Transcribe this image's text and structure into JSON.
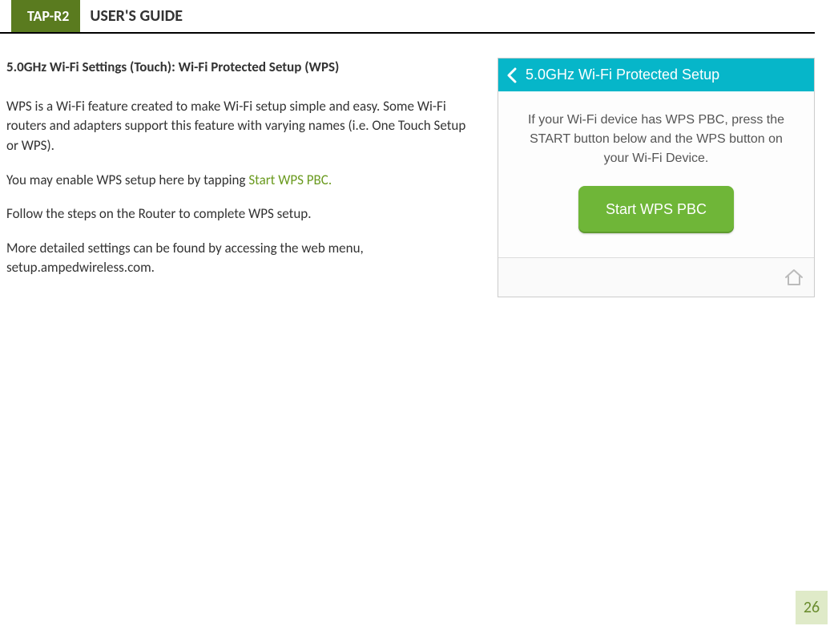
{
  "header": {
    "badge": "TAP-R2",
    "title": "USER'S GUIDE"
  },
  "section": {
    "heading": "5.0GHz Wi-Fi Settings (Touch): Wi-Fi Protected Setup (WPS)",
    "p1": "WPS is a Wi-Fi feature created to make Wi-Fi setup simple and easy.  Some Wi-Fi routers and adapters support this feature with varying names (i.e. One Touch Setup or WPS).",
    "p2_prefix": "You may enable WPS setup here by tapping ",
    "p2_link": "Start WPS PBC.",
    "p3": "Follow the steps on the Router to complete WPS setup.",
    "p4": "More detailed settings can be found by accessing the web menu, setup.ampedwireless.com."
  },
  "device": {
    "topbar_title": "5.0GHz Wi-Fi Protected Setup",
    "body_text": "If your Wi-Fi device has WPS PBC, press the START button below and the WPS button on your Wi-Fi Device.",
    "button_label": "Start WPS PBC"
  },
  "page_number": "26"
}
